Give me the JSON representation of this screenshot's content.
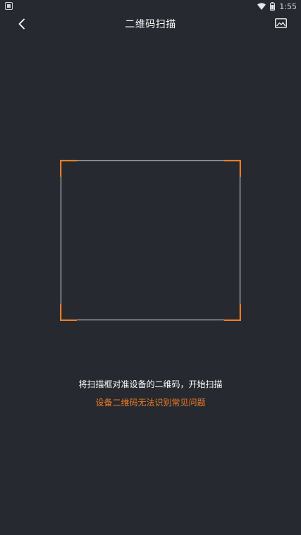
{
  "status_bar": {
    "time": "1:55",
    "icons": [
      "notification-icon",
      "wifi-icon",
      "battery-icon"
    ]
  },
  "header": {
    "title": "二维码扫描",
    "back_icon": "chevron-left-icon",
    "album_icon": "image-icon"
  },
  "scan": {
    "instruction": "将扫描框对准设备的二维码，开始扫描",
    "faq_link": "设备二维码无法识别常见问题"
  },
  "colors": {
    "background": "#262a30",
    "accent": "#f07a23",
    "text": "#ffffff"
  }
}
